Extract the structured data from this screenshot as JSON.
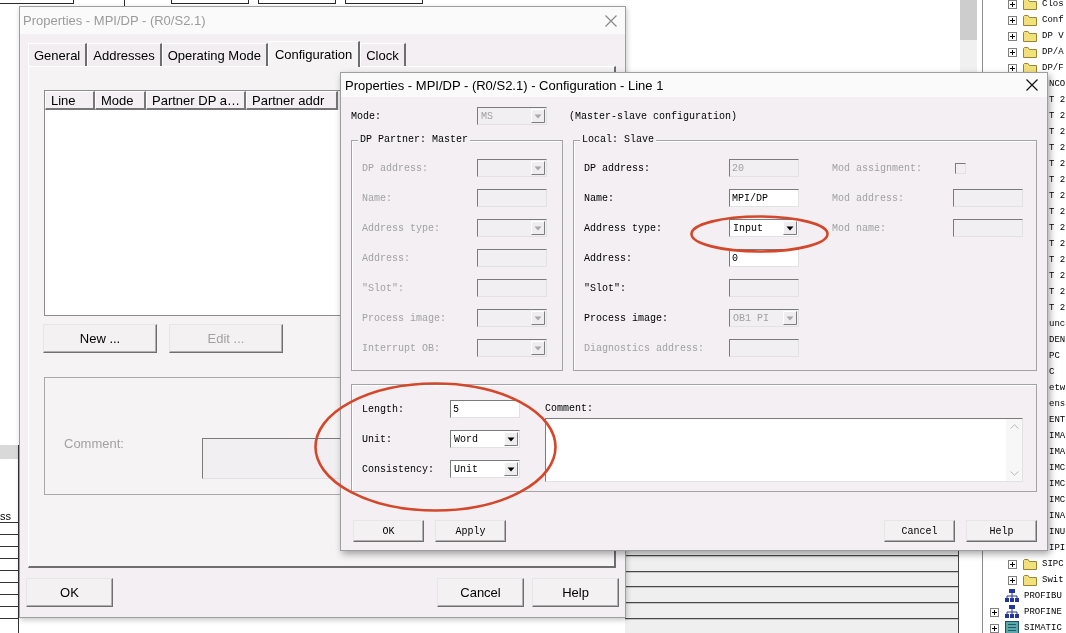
{
  "background": {
    "catalog_tree": {
      "nested_items": [
        {
          "label": "Clos",
          "kind": "folder",
          "expandable": true
        },
        {
          "label": "Conf",
          "kind": "folder",
          "expandable": true
        },
        {
          "label": "DP V",
          "kind": "folder",
          "expandable": true
        },
        {
          "label": "DP/A",
          "kind": "folder",
          "expandable": true
        },
        {
          "label": "DP/F",
          "kind": "folder",
          "expandable": true
        },
        {
          "label": "NCO",
          "kind": "partial"
        },
        {
          "label": "T 2",
          "kind": "partial"
        },
        {
          "label": "T 2",
          "kind": "partial"
        },
        {
          "label": "T 2",
          "kind": "partial"
        },
        {
          "label": "T 2",
          "kind": "partial"
        },
        {
          "label": "T 2",
          "kind": "partial"
        },
        {
          "label": "T 2",
          "kind": "partial"
        },
        {
          "label": "T 2",
          "kind": "partial"
        },
        {
          "label": "T 2",
          "kind": "partial"
        },
        {
          "label": "T 2",
          "kind": "partial"
        },
        {
          "label": "T 2",
          "kind": "partial"
        },
        {
          "label": "T 2",
          "kind": "partial"
        },
        {
          "label": "T 2",
          "kind": "partial"
        },
        {
          "label": "T 2",
          "kind": "partial"
        },
        {
          "label": "T 2",
          "kind": "partial"
        },
        {
          "label": "unc",
          "kind": "partial"
        },
        {
          "label": "DEN",
          "kind": "partial"
        },
        {
          "label": "PC",
          "kind": "partial"
        },
        {
          "label": "C",
          "kind": "partial"
        },
        {
          "label": "etw",
          "kind": "partial"
        },
        {
          "label": "ens",
          "kind": "partial"
        },
        {
          "label": "ENT",
          "kind": "partial"
        },
        {
          "label": "IMA",
          "kind": "partial"
        },
        {
          "label": "IMA",
          "kind": "partial"
        },
        {
          "label": "IMC",
          "kind": "partial"
        },
        {
          "label": "IMC",
          "kind": "partial"
        },
        {
          "label": "IMC",
          "kind": "partial"
        },
        {
          "label": "INA",
          "kind": "partial"
        },
        {
          "label": "INU",
          "kind": "partial"
        },
        {
          "label": "IPI",
          "kind": "partial"
        },
        {
          "label": "SIPC",
          "kind": "folder",
          "expandable": true
        },
        {
          "label": "Swit",
          "kind": "folder",
          "expandable": true
        }
      ],
      "items": [
        {
          "label": "PROFIBU",
          "kind": "network",
          "expandable": false
        },
        {
          "label": "PROFINE",
          "kind": "network",
          "expandable": true
        },
        {
          "label": "SIMATIC",
          "kind": "station",
          "expandable": true
        }
      ]
    },
    "side_table": {
      "column_header": "ss"
    }
  },
  "properties_dialog": {
    "title": "Properties - MPI/DP - (R0/S2.1)",
    "active": false,
    "tabs": [
      {
        "label": "General",
        "selected": false
      },
      {
        "label": "Addresses",
        "selected": false
      },
      {
        "label": "Operating Mode",
        "selected": false
      },
      {
        "label": "Configuration",
        "selected": true
      },
      {
        "label": "Clock",
        "selected": false
      }
    ],
    "connections_table": {
      "columns": [
        "Line",
        "Mode",
        "Partner DP a…",
        "Partner addr"
      ]
    },
    "list_buttons": [
      {
        "label": "New ...",
        "disabled": false
      },
      {
        "label": "Edit ...",
        "disabled": true
      }
    ],
    "comment": {
      "label": "Comment:",
      "disabled": true
    },
    "buttons": {
      "left": [
        "OK"
      ],
      "right": [
        "Cancel",
        "Help"
      ]
    }
  },
  "configuration_dialog": {
    "title": "Properties - MPI/DP - (R0/S2.1) - Configuration - Line 1",
    "active": true,
    "mode": {
      "label": "Mode:",
      "value": "MS",
      "disabled": true,
      "description": "(Master-slave configuration)"
    },
    "dp_partner": {
      "title": "DP Partner: Master",
      "fields": [
        {
          "label": "DP address:",
          "kind": "dropdown",
          "disabled": true
        },
        {
          "label": "Name:",
          "kind": "text",
          "disabled": true
        },
        {
          "label": "Address type:",
          "kind": "dropdown",
          "disabled": true
        },
        {
          "label": "Address:",
          "kind": "text",
          "disabled": true
        },
        {
          "label": "\"Slot\":",
          "kind": "text",
          "disabled": true
        },
        {
          "label": "Process image:",
          "kind": "dropdown",
          "disabled": true
        },
        {
          "label": "Interrupt OB:",
          "kind": "dropdown",
          "disabled": true
        }
      ]
    },
    "local_slave": {
      "title": "Local: Slave",
      "fields": [
        {
          "label": "DP address:",
          "kind": "text",
          "value": "20",
          "disabled": false,
          "read_only": true,
          "circled": false
        },
        {
          "label": "Name:",
          "kind": "text",
          "value": "MPI/DP",
          "disabled": false,
          "read_only": false,
          "circled": false
        },
        {
          "label": "Address type:",
          "kind": "dropdown",
          "value": "Input",
          "disabled": false,
          "read_only": false,
          "circled": true
        },
        {
          "label": "Address:",
          "kind": "text",
          "value": "0",
          "disabled": false,
          "read_only": false,
          "circled": false
        },
        {
          "label": "\"Slot\":",
          "kind": "text",
          "disabled": false,
          "read_only": true,
          "circled": false
        },
        {
          "label": "Process image:",
          "kind": "dropdown",
          "value": "OB1 PI",
          "disabled": false,
          "read_only": true,
          "circled": false
        },
        {
          "label": "Diagnostics address:",
          "kind": "text",
          "disabled": true,
          "read_only": false,
          "circled": false
        }
      ],
      "module_fields": [
        {
          "label": "Mod assignment:",
          "kind": "checkbox",
          "checked": false,
          "disabled": true
        },
        {
          "label": "Mod address:",
          "kind": "text",
          "disabled": true
        },
        {
          "label": "Mod name:",
          "kind": "text",
          "disabled": true
        }
      ]
    },
    "data_format": {
      "circled": true,
      "fields": [
        {
          "label": "Length:",
          "kind": "text",
          "value": "5",
          "disabled": false
        },
        {
          "label": "Unit:",
          "kind": "dropdown",
          "value": "Word",
          "disabled": false
        },
        {
          "label": "Consistency:",
          "kind": "dropdown",
          "value": "Unit",
          "disabled": false
        }
      ],
      "comment": {
        "label": "Comment:"
      }
    },
    "buttons": {
      "left": [
        "OK",
        "Apply"
      ],
      "right": [
        "Cancel",
        "Help"
      ]
    }
  }
}
